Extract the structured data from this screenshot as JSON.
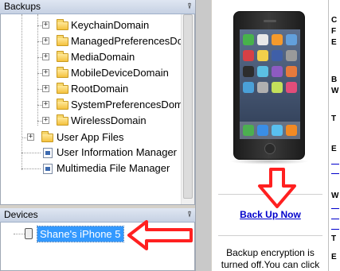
{
  "backups_panel": {
    "title": "Backups",
    "pin_glyph": "⍒",
    "tree": [
      {
        "label": "KeychainDomain",
        "type": "folder",
        "expander": "+"
      },
      {
        "label": "ManagedPreferencesDo",
        "type": "folder",
        "expander": "+"
      },
      {
        "label": "MediaDomain",
        "type": "folder",
        "expander": "+"
      },
      {
        "label": "MobileDeviceDomain",
        "type": "folder",
        "expander": "+"
      },
      {
        "label": "RootDomain",
        "type": "folder",
        "expander": "+"
      },
      {
        "label": "SystemPreferencesDom",
        "type": "folder",
        "expander": "+"
      },
      {
        "label": "WirelessDomain",
        "type": "folder",
        "expander": "+"
      },
      {
        "label": "User App Files",
        "type": "folder",
        "expander": "+"
      },
      {
        "label": "User Information Manager",
        "type": "file",
        "expander": ""
      },
      {
        "label": "Multimedia File Manager",
        "type": "file",
        "expander": ""
      }
    ]
  },
  "devices_panel": {
    "title": "Devices",
    "pin_glyph": "⍒",
    "selected_device": "Shane's iPhone 5"
  },
  "content": {
    "backup_link": "Back Up Now",
    "encryption_text": "Backup encryption is turned off.You can click",
    "side_letters": [
      "C",
      "F",
      "E",
      "B",
      "W",
      "T",
      "E",
      "W",
      "T",
      "E"
    ]
  },
  "colors": {
    "selection": "#3399ff",
    "link": "#0000cc",
    "annotation_arrow": "#ff2020"
  }
}
